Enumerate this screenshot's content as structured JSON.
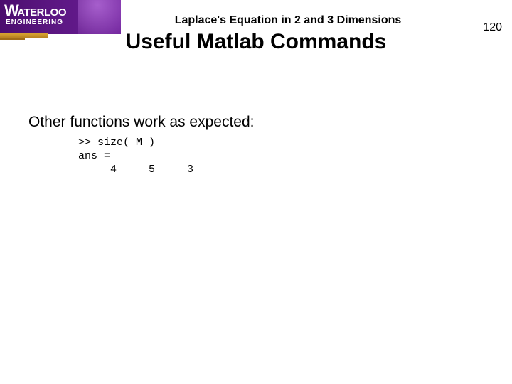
{
  "logo": {
    "w": "W",
    "rest": "ATERLOO",
    "sub": "ENGINEERING"
  },
  "header": {
    "course_title": "Laplace's Equation in 2 and 3 Dimensions"
  },
  "slide": {
    "title": "Useful Matlab Commands",
    "page_number": "120"
  },
  "body": {
    "lead": "Other functions work as expected:"
  },
  "code": {
    "line1": ">> size( M )",
    "line2": "ans =",
    "line3": "     4     5     3"
  }
}
